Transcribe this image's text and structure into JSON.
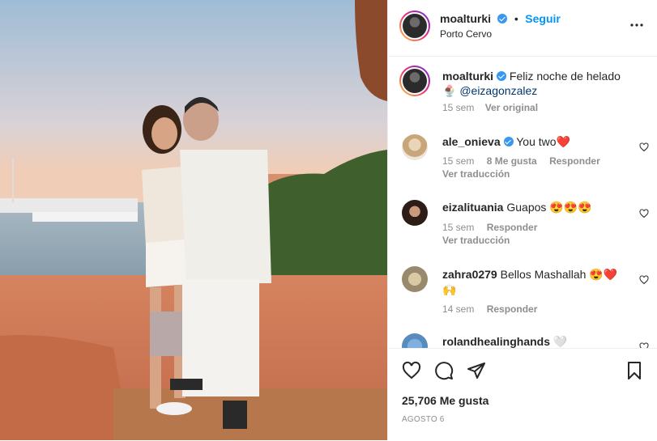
{
  "post": {
    "username": "moalturki",
    "follow_label": "Seguir",
    "location": "Porto Cervo",
    "more_icon": "more-options-icon",
    "caption": {
      "username": "moalturki",
      "text": "Feliz noche de helado",
      "emoji": "🍨",
      "mention": "@eizagonzalez",
      "time": "15 sem",
      "see_original": "Ver original"
    },
    "comments": [
      {
        "username": "ale_onieva",
        "verified": true,
        "text": "You two❤️",
        "time": "15 sem",
        "likes": "8 Me gusta",
        "reply": "Responder",
        "translate": "Ver traducción"
      },
      {
        "username": "eizalituania",
        "verified": false,
        "text": "Guapos 😍😍😍",
        "time": "15 sem",
        "likes": "",
        "reply": "Responder",
        "translate": "Ver traducción"
      },
      {
        "username": "zahra0279",
        "verified": false,
        "text": "Bellos Mashallah 😍❤️",
        "text2": "🙌",
        "time": "14 sem",
        "likes": "",
        "reply": "Responder",
        "translate": ""
      },
      {
        "username": "rolandhealinghands",
        "verified": false,
        "text": "🤍"
      }
    ],
    "likes_count": "25,706 Me gusta",
    "date": "AGOSTO 6"
  },
  "colors": {
    "accent": "#0095f6",
    "verified": "#3897f0",
    "heart": "#ed4956"
  }
}
